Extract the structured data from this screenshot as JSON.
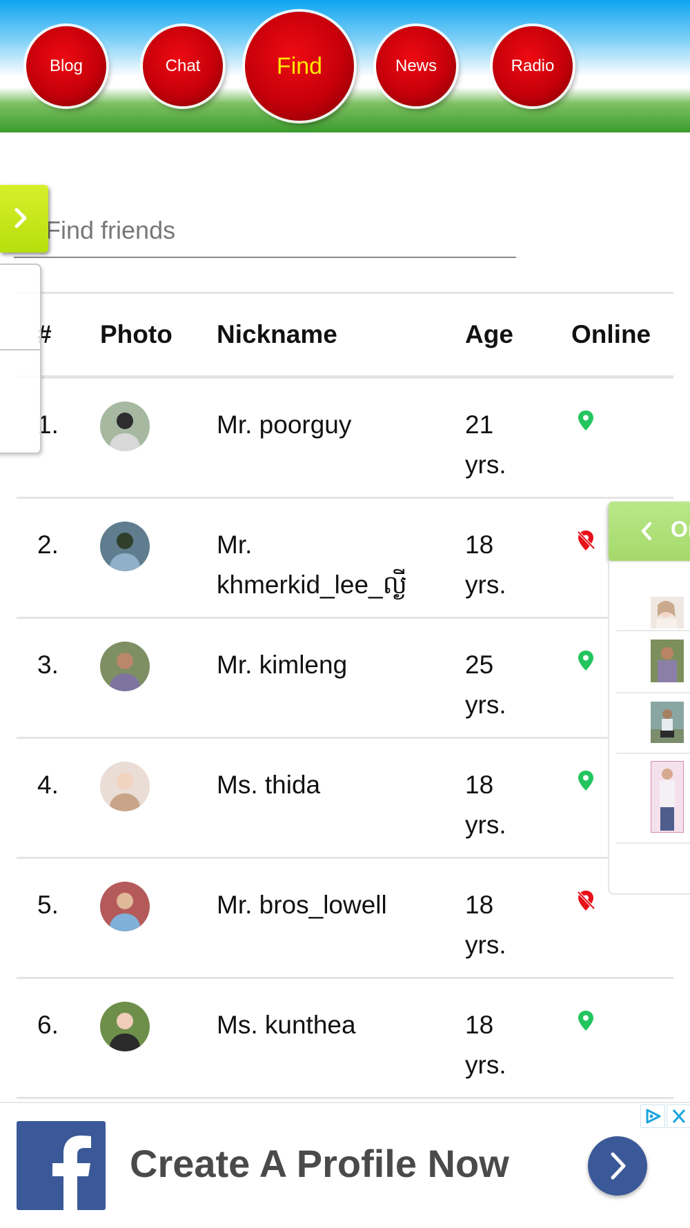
{
  "nav": {
    "items": [
      {
        "label": "Blog"
      },
      {
        "label": "Chat"
      },
      {
        "label": "Find",
        "active": true
      },
      {
        "label": "News"
      },
      {
        "label": "Radio"
      }
    ],
    "button_color": "#d10009",
    "active_text_color": "#ffe800"
  },
  "search": {
    "placeholder": "Find friends",
    "value": ""
  },
  "table": {
    "headers": {
      "num": "#",
      "photo": "Photo",
      "nickname": "Nickname",
      "age": "Age",
      "online": "Online"
    },
    "rows": [
      {
        "num": "1.",
        "nickname": "Mr. poorguy",
        "age": "21 yrs.",
        "online": true,
        "avatar": "avatar-photo-icon"
      },
      {
        "num": "2.",
        "nickname": "Mr. khmerkid_lee_ល្ងី",
        "age": "18 yrs.",
        "online": false,
        "avatar": "avatar-photo-icon"
      },
      {
        "num": "3.",
        "nickname": "Mr. kimleng",
        "age": "25 yrs.",
        "online": true,
        "avatar": "avatar-photo-icon"
      },
      {
        "num": "4.",
        "nickname": "Ms. thida",
        "age": "18 yrs.",
        "online": true,
        "avatar": "avatar-photo-icon"
      },
      {
        "num": "5.",
        "nickname": "Mr. bros_lowell",
        "age": "18 yrs.",
        "online": false,
        "avatar": "avatar-photo-icon"
      },
      {
        "num": "6.",
        "nickname": "Ms. kunthea",
        "age": "18 yrs.",
        "online": true,
        "avatar": "avatar-photo-icon"
      }
    ],
    "online_color": "#22c55e",
    "offline_color": "#e8101a"
  },
  "online_panel": {
    "tab_label": "Or",
    "tab_color": "#b3e37c"
  },
  "side_tab": {
    "color": "#c9e81c"
  },
  "ad": {
    "text": "Create A Profile Now",
    "brand_color": "#3b5998"
  }
}
